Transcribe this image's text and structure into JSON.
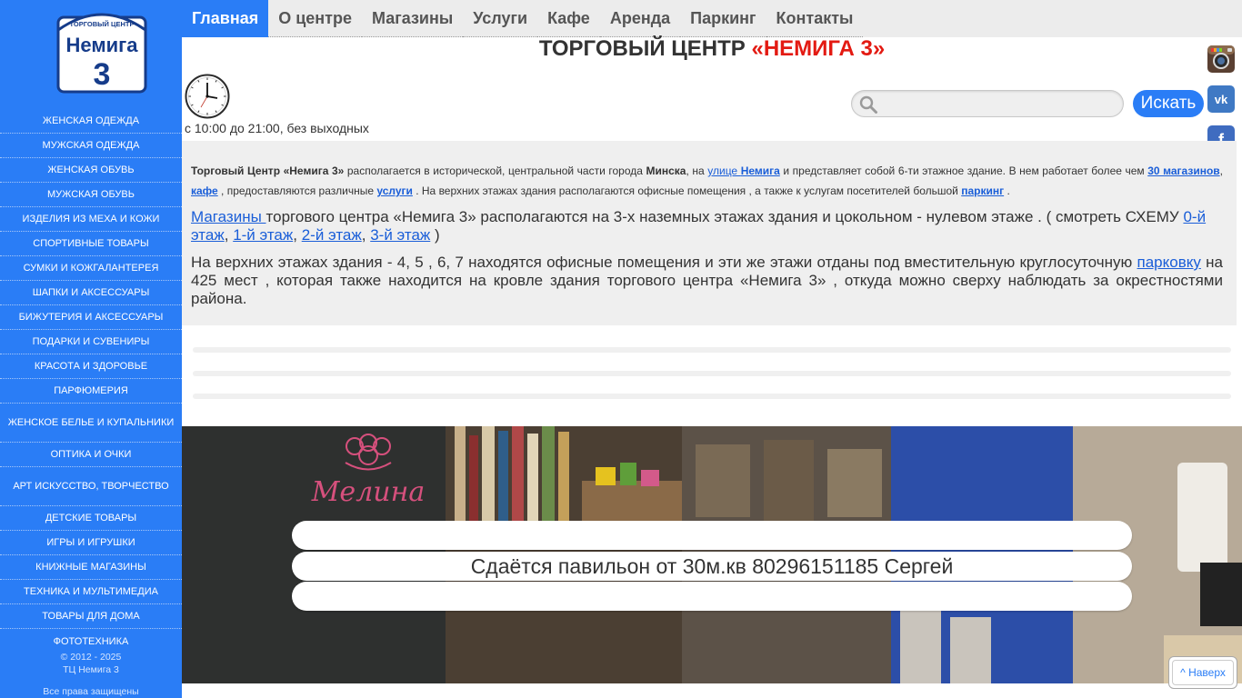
{
  "site": {
    "logo": {
      "top_text": "ТОРГОВЫЙ ЦЕНТР",
      "name": "Немига",
      "number": "3"
    }
  },
  "nav": {
    "items": [
      "Главная",
      "О центре",
      "Магазины",
      "Услуги",
      "Кафе",
      "Аренда",
      "Паркинг",
      "Контакты"
    ],
    "active": "Главная"
  },
  "header": {
    "title_part1": "ТОРГОВЫЙ ЦЕНТР ",
    "title_part2": "«НЕМИГА 3»",
    "hours": "с 10:00 до 21:00, без выходных"
  },
  "search": {
    "value": "",
    "button": "Искать"
  },
  "social": [
    "instagram-icon",
    "vk-icon",
    "facebook-icon",
    "parking-icon"
  ],
  "sidebar": {
    "categories": [
      "ЖЕНСКАЯ ОДЕЖДА",
      "МУЖСКАЯ ОДЕЖДА",
      "ЖЕНСКАЯ ОБУВЬ",
      "МУЖСКАЯ ОБУВЬ",
      "ИЗДЕЛИЯ ИЗ МЕХА И КОЖИ",
      "СПОРТИВНЫЕ ТОВАРЫ",
      "СУМКИ И КОЖГАЛАНТЕРЕЯ",
      "ШАПКИ И АКСЕССУАРЫ",
      "БИЖУТЕРИЯ И АКСЕССУАРЫ",
      "ПОДАРКИ И СУВЕНИРЫ",
      "КРАСОТА И ЗДОРОВЬЕ",
      "ПАРФЮМЕРИЯ",
      "ЖЕНСКОЕ БЕЛЬЕ И КУПАЛЬНИКИ",
      "ОПТИКА И ОЧКИ",
      "АРТ ИСКУССТВО, ТВОРЧЕСТВО",
      "ДЕТСКИЕ ТОВАРЫ",
      "ИГРЫ И ИГРУШКИ",
      "КНИЖНЫЕ МАГАЗИНЫ",
      "ТЕХНИКА И МУЛЬТИМЕДИА",
      "ТОВАРЫ ДЛЯ ДОМА",
      "ФОТОТЕХНИКА"
    ],
    "footer_years": "© 2012 - 2025",
    "footer_name": "ТЦ Немига 3",
    "footer_rights": "Все права защищены"
  },
  "intro": {
    "p1": {
      "t1": "Торговый Центр «Немига 3»",
      "t2": "  располагается в исторической, центральной части города ",
      "t3": "Минска",
      "t4": ", на ",
      "l1a": "улице ",
      "l1b": "Немига",
      "t5": " и представляет собой 6-ти этажное здание.  В нем работает более чем  ",
      "l2": "30 магазинов",
      "t6": ",   ",
      "l3": "кафе",
      "t7": " , предоставляются  различные  ",
      "l4": "услуги",
      "t8": " . На верхних этажах здания располагаются офисные помещения  , а также к услугам посетителей большой  ",
      "l5": "паркинг",
      "t9": " ."
    },
    "p2": {
      "l1": "Магазины ",
      "t1": "  торгового центра «Немига 3»  располагаются на  3-х наземных этажах здания и цокольном  - нулевом этаже . ( смотреть СХЕМУ  ",
      "l2": "0-й этаж",
      "t2": ",  ",
      "l3": "1-й этаж",
      "t3": ",   ",
      "l4": "2-й этаж",
      "t4": ",   ",
      "l5": "3-й этаж",
      "t5": " )"
    },
    "p3": {
      "t1": " На верхних этажах  здания  -  4, 5 , 6, 7  находятся  офисные помещения и эти же этажи отданы под вместительную круглосуточную ",
      "l1": "парковку",
      "t2": "  на 425  мест  , которая  также  находится  на кровле здания торгового центра «Немига 3»  , откуда можно сверху  наблюдать за окрестностями района."
    }
  },
  "banner": {
    "text": "Сдаётся павильон от 30м.кв 80296151185 Сергей",
    "sign_text": "Мелина"
  },
  "totop": {
    "label": "Наверх"
  },
  "colors": {
    "primary": "#2a7df6",
    "accent": "#e31a12",
    "panel": "#efefef"
  }
}
